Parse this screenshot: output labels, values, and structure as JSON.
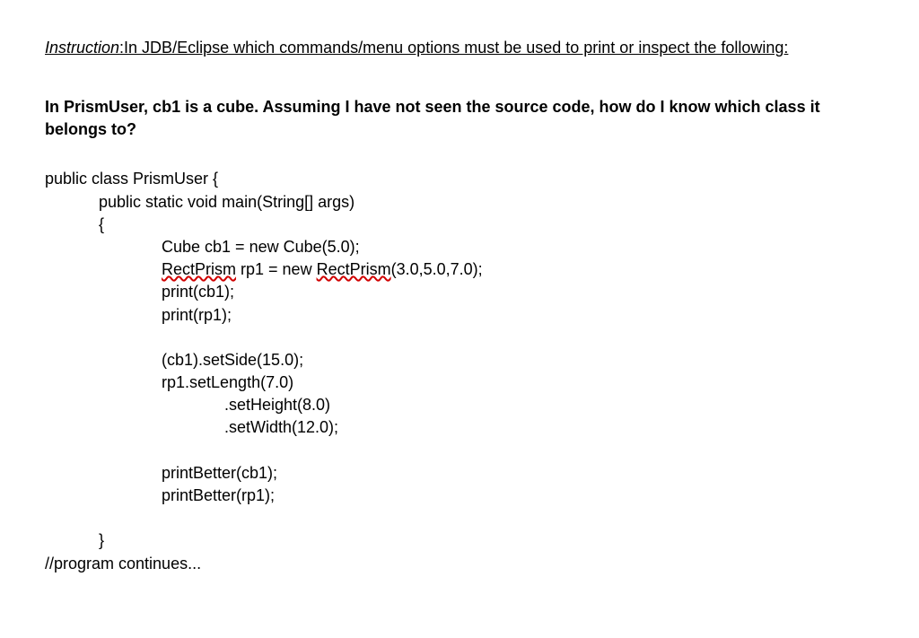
{
  "instruction": {
    "label": "Instruction",
    "text": ":In JDB/Eclipse which commands/menu options must be used to print or inspect the following:"
  },
  "question": "In PrismUser, cb1 is a cube. Assuming I have not seen the source code, how do I know which class it belongs to?",
  "code": {
    "l1": "public class PrismUser {",
    "l2": "public static void main(String[] args)",
    "l3": "{",
    "l4_a": "Cube  cb1 = new Cube(5.0);",
    "l5_a": "RectPrism",
    "l5_b": " rp1 = new ",
    "l5_c": "RectPrism",
    "l5_d": "(3.0,5.0,7.0);",
    "l6": "print(cb1);",
    "l7": "print(rp1);",
    "l8": "(cb1).setSide(15.0);",
    "l9": "rp1.setLength(7.0)",
    "l10": ".setHeight(8.0)",
    "l11": ".setWidth(12.0);",
    "l12": "printBetter(cb1);",
    "l13": "printBetter(rp1);",
    "l14": "}",
    "l15": "//program continues..."
  }
}
